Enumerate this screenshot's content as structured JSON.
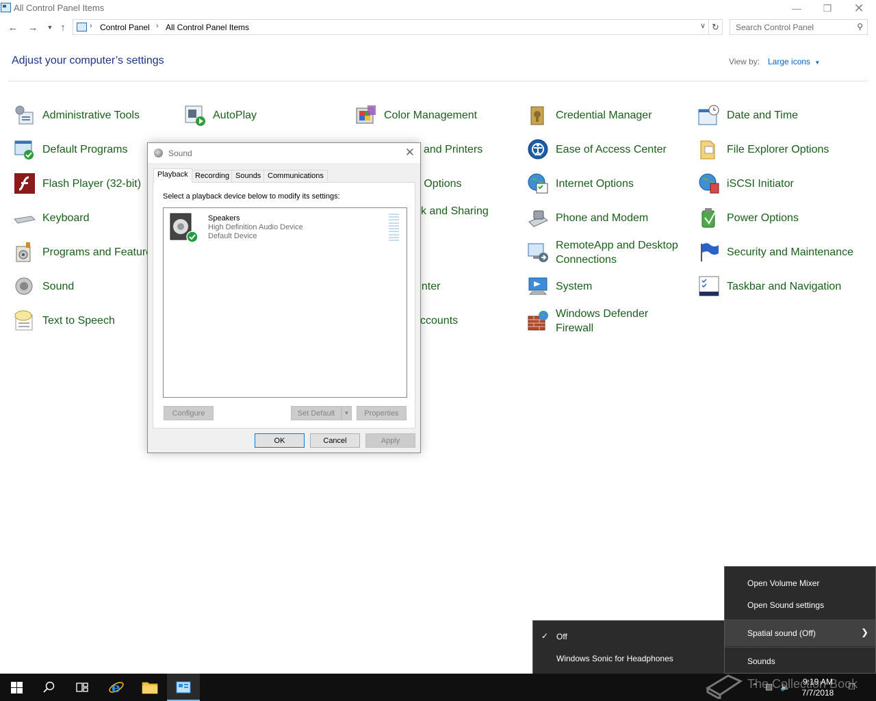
{
  "window": {
    "title": "All Control Panel Items"
  },
  "address": {
    "crumbs": [
      "Control Panel",
      "All Control Panel Items"
    ],
    "search_placeholder": "Search Control Panel"
  },
  "header": {
    "title": "Adjust your computer’s settings",
    "view_by_label": "View by:",
    "view_by_value": "Large icons"
  },
  "items": {
    "c1": [
      "Administrative Tools",
      "Default Programs",
      "Flash Player (32-bit)",
      "Keyboard",
      "Programs and Features",
      "Sound",
      "Text to Speech"
    ],
    "c2": [
      "AutoPlay"
    ],
    "c3": [
      "Color Management",
      "and Printers",
      "g Options",
      "k and Sharing",
      "enter",
      "ccounts"
    ],
    "c4": [
      "Credential Manager",
      "Ease of Access Center",
      "Internet Options",
      "Phone and Modem",
      "RemoteApp and Desktop Connections",
      "System",
      "Windows Defender Firewall"
    ],
    "c5": [
      "Date and Time",
      "File Explorer Options",
      "iSCSI Initiator",
      "Power Options",
      "Security and Maintenance",
      "Taskbar and Navigation"
    ]
  },
  "dialog": {
    "title": "Sound",
    "tabs": [
      "Playback",
      "Recording",
      "Sounds",
      "Communications"
    ],
    "instruction": "Select a playback device below to modify its settings:",
    "device": {
      "name": "Speakers",
      "description": "High Definition Audio Device",
      "status": "Default Device"
    },
    "buttons": {
      "configure": "Configure",
      "set_default": "Set Default",
      "properties": "Properties",
      "ok": "OK",
      "cancel": "Cancel",
      "apply": "Apply"
    }
  },
  "context_menu": {
    "items": [
      "Open Volume Mixer",
      "Open Sound settings",
      "Spatial sound (Off)",
      "Sounds"
    ]
  },
  "submenu": {
    "items": [
      "Off",
      "Windows Sonic for Headphones"
    ]
  },
  "taskbar": {
    "time": "9:19 AM",
    "date": "7/7/2018"
  },
  "watermark": {
    "text": "The Collection Book"
  }
}
